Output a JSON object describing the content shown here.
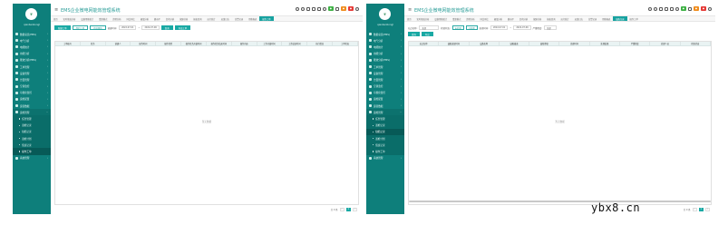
{
  "app_title": "EMS企业微电网能效管理系统",
  "watermark": "ybx8.cn",
  "panel1": {
    "user": "qiaobenbongl",
    "sidebar": [
      {
        "label": "数据总览(EMS)",
        "kind": "item"
      },
      {
        "label": "电气分析",
        "kind": "item"
      },
      {
        "label": "电能统计",
        "kind": "item"
      },
      {
        "label": "用能分析",
        "kind": "item"
      },
      {
        "label": "能效分析(EMS)",
        "kind": "item"
      },
      {
        "label": "工单管理",
        "kind": "item"
      },
      {
        "label": "设备管理",
        "kind": "item"
      },
      {
        "label": "告警管理",
        "kind": "item"
      },
      {
        "label": "空调监控",
        "kind": "item"
      },
      {
        "label": "可视化监控",
        "kind": "item"
      },
      {
        "label": "运维配置",
        "kind": "item"
      },
      {
        "label": "运营数据",
        "kind": "item"
      },
      {
        "label": "运维管理",
        "kind": "open"
      },
      {
        "label": "任务管理",
        "kind": "sub"
      },
      {
        "label": "巡检记录",
        "kind": "sub"
      },
      {
        "label": "缺陷记录",
        "kind": "sub"
      },
      {
        "label": "巡检计划",
        "kind": "sub"
      },
      {
        "label": "值班记录",
        "kind": "sub"
      },
      {
        "label": "操作工单",
        "kind": "active"
      },
      {
        "label": "系统管理",
        "kind": "item"
      }
    ],
    "tabs": [
      "首页",
      "实时能效分析",
      "设备用能统计",
      "重复模式",
      "趋势分析",
      "同比环比",
      "极值分析",
      "峰谷平",
      "负荷分析",
      "故障分析",
      "报表查询",
      "运行统计",
      "运维日志",
      "告警记录",
      "用能报表",
      "操作工单"
    ],
    "active_tab": 15,
    "filters": {
      "btn_new": "新建工单",
      "btn_mine": "我的工单",
      "btn_todo": "待处理的",
      "date_label": "创建时间:",
      "date_from": "2022-07-01",
      "date_to": "2022-07-06",
      "btn_search": "查询",
      "btn_export": "导出工单"
    },
    "columns": [
      "工单编号",
      "任务",
      "创建人",
      "操作时间",
      "操作类型",
      "操作任务开始时间",
      "操作任务结束时间",
      "操作内容",
      "工作开始时间",
      "工作结束时间",
      "执行情况",
      "工单状态"
    ],
    "empty_text": "暂无数据",
    "pager": {
      "total": "共 0 条",
      "page": "1"
    }
  },
  "panel2": {
    "user": "qiaobenbongl",
    "sidebar": [
      {
        "label": "数据总览(EMS)",
        "kind": "item"
      },
      {
        "label": "电气分析",
        "kind": "item"
      },
      {
        "label": "电能统计",
        "kind": "item"
      },
      {
        "label": "用能分析",
        "kind": "item"
      },
      {
        "label": "能效分析(EMS)",
        "kind": "item"
      },
      {
        "label": "工单管理",
        "kind": "item"
      },
      {
        "label": "设备管理",
        "kind": "item"
      },
      {
        "label": "告警管理",
        "kind": "item"
      },
      {
        "label": "空调监控",
        "kind": "item"
      },
      {
        "label": "可视化监控",
        "kind": "item"
      },
      {
        "label": "运维配置",
        "kind": "item"
      },
      {
        "label": "运营数据",
        "kind": "item"
      },
      {
        "label": "运维管理",
        "kind": "open"
      },
      {
        "label": "任务管理",
        "kind": "sub"
      },
      {
        "label": "巡检记录",
        "kind": "sub"
      },
      {
        "label": "缺陷记录",
        "kind": "active"
      },
      {
        "label": "巡检计划",
        "kind": "sub"
      },
      {
        "label": "值班记录",
        "kind": "sub"
      },
      {
        "label": "操作工单",
        "kind": "sub"
      },
      {
        "label": "系统管理",
        "kind": "item"
      }
    ],
    "tabs": [
      "首页",
      "实时能效分析",
      "设备用能统计",
      "重复模式",
      "趋势分析",
      "同比环比",
      "极值分析",
      "峰谷平",
      "负荷分析",
      "故障分析",
      "报表查询",
      "运行统计",
      "运维日志",
      "告警记录",
      "用能报表",
      "缺陷记录",
      "操作工单"
    ],
    "active_tab": 15,
    "filters": {
      "station_label": "站点名称:",
      "station_value": "全部",
      "check_label": "检修状态:",
      "check_a": "未处理",
      "check_b": "已处理",
      "date_label": "发现时间:",
      "date_from": "2022-07-01",
      "date_to": "2022-07-06",
      "level_label": "严重程度:",
      "level_value": "全部",
      "btn_search": "查询",
      "btn_export": "导出"
    },
    "columns": [
      "站点名称",
      "缺陷发现时间",
      "设备名称",
      "缺陷描述",
      "缺陷等级",
      "处理时间",
      "处理结果",
      "严重程度",
      "处理人员",
      "检修状态"
    ],
    "empty_text": "暂无数据",
    "pager": {
      "total": "共 0 条",
      "page": "1"
    }
  }
}
